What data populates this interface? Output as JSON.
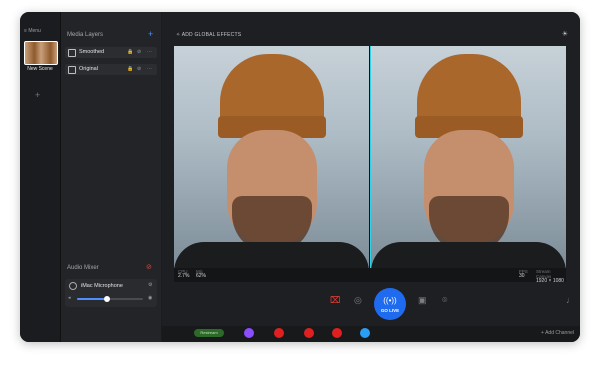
{
  "scenes": {
    "menu_label": "Menu",
    "items": [
      {
        "label": "New Scene"
      }
    ],
    "add_symbol": "+"
  },
  "media_layers": {
    "title": "Media Layers",
    "add_symbol": "+",
    "layers": [
      {
        "label": "Smoothed"
      },
      {
        "label": "Original"
      }
    ]
  },
  "audio_mixer": {
    "title": "Audio Mixer",
    "devices": [
      {
        "label": "iMac Microphone",
        "volume": 0.45
      }
    ]
  },
  "toolbar": {
    "effects_label": "ADD GLOBAL EFFECTS"
  },
  "stats": {
    "left": [
      {
        "label": "CPU",
        "value": "2.7%"
      },
      {
        "label": "Mic",
        "value": "62%"
      }
    ],
    "right": [
      {
        "label": "FPS",
        "value": "30"
      },
      {
        "label": "Stream Canvas",
        "value": "1920 × 1080"
      }
    ]
  },
  "controls": {
    "go_live_label": "GO LIVE"
  },
  "channels": {
    "restream_label": "Restream",
    "items": [
      {
        "name": "twitch",
        "color": "#8a4dff"
      },
      {
        "name": "youtube",
        "color": "#e02020"
      },
      {
        "name": "youtube",
        "color": "#e02020"
      },
      {
        "name": "youtube",
        "color": "#e02020"
      },
      {
        "name": "twitter",
        "color": "#2a9df4"
      }
    ],
    "add_label": "Add Channel"
  },
  "colors": {
    "accent": "#1e6bf0",
    "divider": "#2fd3e8"
  }
}
